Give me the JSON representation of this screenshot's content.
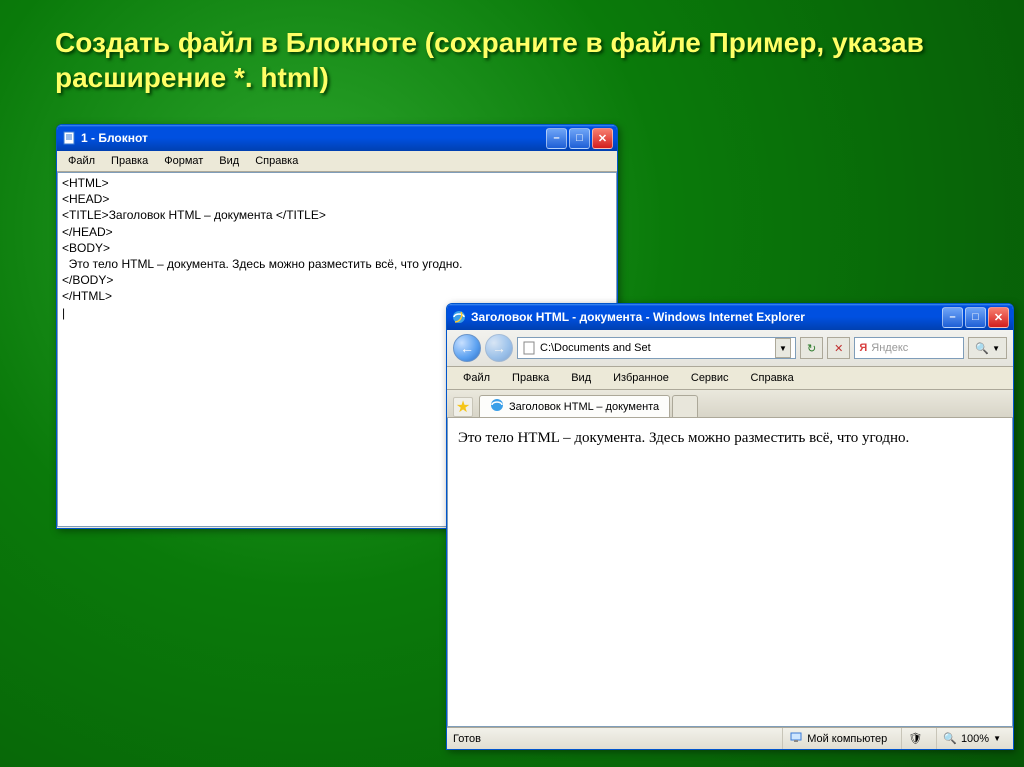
{
  "slide": {
    "title": "Создать файл в Блокноте (сохраните в файле Пример,  указав расширение  *. html)"
  },
  "notepad": {
    "title": "1 - Блокнот",
    "menu": {
      "file": "Файл",
      "edit": "Правка",
      "format": "Формат",
      "view": "Вид",
      "help": "Справка"
    },
    "content": "<HTML>\n<HEAD>\n<TITLE>Заголовок HTML – документа </TITLE>\n</HEAD>\n<BODY>\n  Это тело HTML – документа. Здесь можно разместить всё, что угодно.\n</BODY>\n</HTML>\n|"
  },
  "ie": {
    "title": "Заголовок HTML - документа - Windows Internet Explorer",
    "address": "C:\\Documents and Set",
    "search_placeholder": "Яндекс",
    "menu": {
      "file": "Файл",
      "edit": "Правка",
      "view": "Вид",
      "favorites": "Избранное",
      "tools": "Сервис",
      "help": "Справка"
    },
    "tab_label": "Заголовок HTML – документа",
    "body_text": "Это тело HTML – документа. Здесь можно разместить всё, что угодно.",
    "status": {
      "ready": "Готов",
      "zone": "Мой компьютер",
      "zoom": "100%"
    }
  },
  "colors": {
    "xp_blue": "#0050e0",
    "xp_red": "#d31e1e",
    "slide_title": "#ffff66"
  }
}
